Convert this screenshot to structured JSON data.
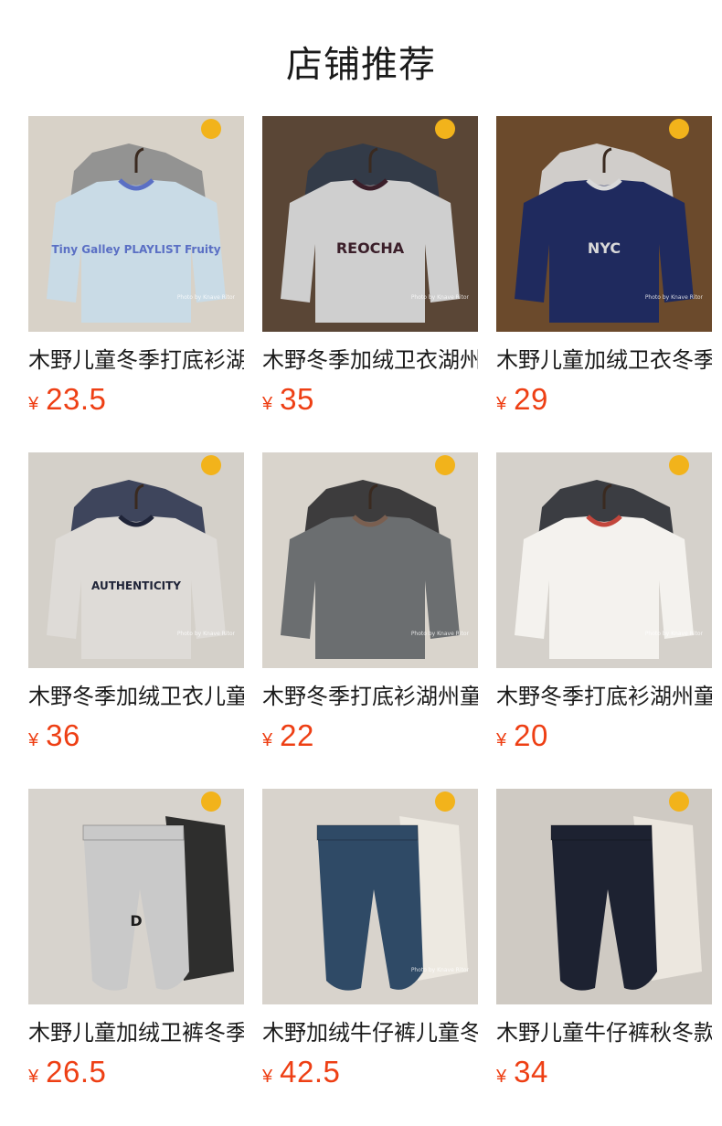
{
  "section_title": "店铺推荐",
  "currency_symbol": "¥",
  "products": [
    {
      "name": "木野儿童冬季打底衫湖州童装",
      "price": "23.5",
      "image_icon": "sweatshirt-photo",
      "print_text": "Tiny Galley PLAYLIST Fruity",
      "watermark": "Photo by Knave Ritor",
      "colors": {
        "bg": "#d8d2c8",
        "main": "#c9dbe6",
        "accent": "#5a6fc4",
        "back": "#8c8c8c"
      }
    },
    {
      "name": "木野冬季加绒卫衣湖州童装",
      "price": "35",
      "image_icon": "sweatshirt-photo",
      "print_text": "REOCHA",
      "watermark": "Photo by Knave Ritor",
      "colors": {
        "bg": "#5a4636",
        "main": "#cfcfcf",
        "accent": "#3b1f2a",
        "back": "#2f3a4a"
      }
    },
    {
      "name": "木野儿童加绒卫衣冬季童装",
      "price": "29",
      "image_icon": "sweatshirt-photo",
      "print_text": "NYC",
      "watermark": "Photo by Knave Ritor",
      "colors": {
        "bg": "#6b4a2c",
        "main": "#1f2a5e",
        "accent": "#d9d9d9",
        "back": "#dcdcdc"
      }
    },
    {
      "name": "木野冬季加绒卫衣儿童上衣",
      "price": "36",
      "image_icon": "sweatshirt-photo",
      "print_text": "AUTHENTICITY",
      "watermark": "Photo by Knave Ritor",
      "colors": {
        "bg": "#d4d0c9",
        "main": "#dedbd7",
        "accent": "#1f2438",
        "back": "#2e3550"
      }
    },
    {
      "name": "木野冬季打底衫湖州童装",
      "price": "22",
      "image_icon": "sweatshirt-photo",
      "print_text": "",
      "watermark": "Photo by Knave Ritor",
      "colors": {
        "bg": "#d9d4cc",
        "main": "#6b6e70",
        "accent": "#7a5f50",
        "back": "#2b2b2e"
      }
    },
    {
      "name": "木野冬季打底衫湖州童装",
      "price": "20",
      "image_icon": "sweatshirt-photo",
      "print_text": "",
      "watermark": "Photo by Knave Ritor",
      "colors": {
        "bg": "#d5d1cb",
        "main": "#f4f2ee",
        "accent": "#c2463c",
        "back": "#2a2c33"
      }
    },
    {
      "name": "木野儿童加绒卫裤冬季童装",
      "price": "26.5",
      "image_icon": "pants-photo",
      "print_text": "D",
      "watermark": "",
      "colors": {
        "bg": "#d7d3cd",
        "main": "#c9c9c9",
        "accent": "#1c1c1c",
        "back": "#1c1c1c"
      }
    },
    {
      "name": "木野加绒牛仔裤儿童冬季",
      "price": "42.5",
      "image_icon": "pants-photo",
      "print_text": "",
      "watermark": "Photo by Knave Ritor",
      "colors": {
        "bg": "#d8d3cc",
        "main": "#2f4a66",
        "accent": "#f0ebe3",
        "back": "#f0ebe3"
      }
    },
    {
      "name": "木野儿童牛仔裤秋冬款",
      "price": "34",
      "image_icon": "pants-photo",
      "print_text": "",
      "watermark": "",
      "colors": {
        "bg": "#cfcac3",
        "main": "#1d2231",
        "accent": "#eeeae2",
        "back": "#eeeae2"
      }
    }
  ]
}
